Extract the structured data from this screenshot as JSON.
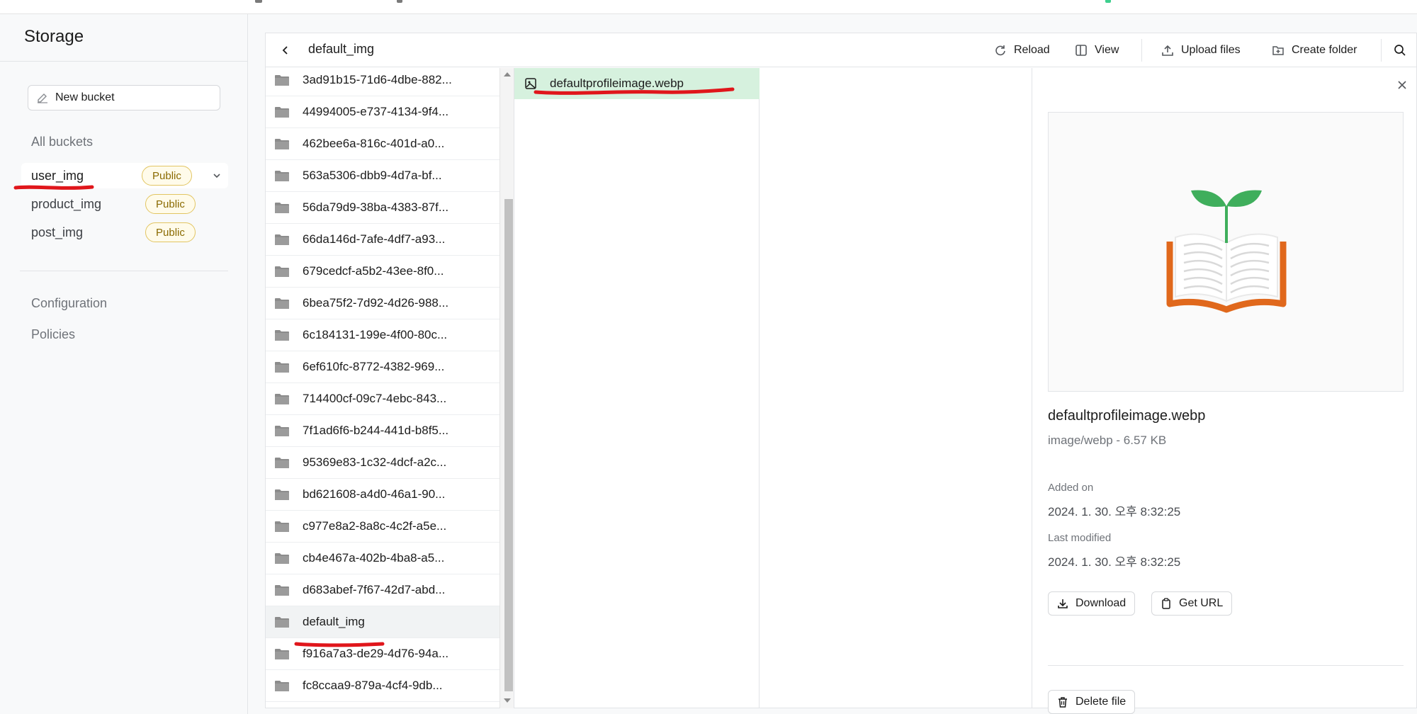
{
  "sidebar": {
    "title": "Storage",
    "new_bucket_label": "New bucket",
    "all_buckets_label": "All buckets",
    "buckets": [
      {
        "name": "user_img",
        "badge": "Public"
      },
      {
        "name": "product_img",
        "badge": "Public"
      },
      {
        "name": "post_img",
        "badge": "Public"
      }
    ],
    "configuration_label": "Configuration",
    "policies_label": "Policies"
  },
  "toolbar": {
    "breadcrumb": "default_img",
    "reload_label": "Reload",
    "view_label": "View",
    "upload_label": "Upload files",
    "create_folder_label": "Create folder"
  },
  "folders": [
    "3ad91b15-71d6-4dbe-882...",
    "44994005-e737-4134-9f4...",
    "462bee6a-816c-401d-a0...",
    "563a5306-dbb9-4d7a-bf...",
    "56da79d9-38ba-4383-87f...",
    "66da146d-7afe-4df7-a93...",
    "679cedcf-a5b2-43ee-8f0...",
    "6bea75f2-7d92-4d26-988...",
    "6c184131-199e-4f00-80c...",
    "6ef610fc-8772-4382-969...",
    "714400cf-09c7-4ebc-843...",
    "7f1ad6f6-b244-441d-b8f5...",
    "95369e83-1c32-4dcf-a2c...",
    "bd621608-a4d0-46a1-90...",
    "c977e8a2-8a8c-4c2f-a5e...",
    "cb4e467a-402b-4ba8-a5...",
    "d683abef-7f67-42d7-abd...",
    "default_img",
    "f916a7a3-de29-4d76-94a...",
    "fc8ccaa9-879a-4cf4-9db..."
  ],
  "selected_folder": "default_img",
  "files": [
    "defaultprofileimage.webp"
  ],
  "details": {
    "file_name": "defaultprofileimage.webp",
    "meta": "image/webp - 6.57 KB",
    "added_on_label": "Added on",
    "added_on_value": "2024. 1. 30. 오후 8:32:25",
    "last_modified_label": "Last modified",
    "last_modified_value": "2024. 1. 30. 오후 8:32:25",
    "download_label": "Download",
    "get_url_label": "Get URL",
    "delete_label": "Delete file"
  },
  "colors": {
    "accent_green": "#3ecf8e",
    "selected_file_bg": "#d6f1de",
    "badge_border": "#e2c562",
    "annotation_red": "#e0161b"
  }
}
